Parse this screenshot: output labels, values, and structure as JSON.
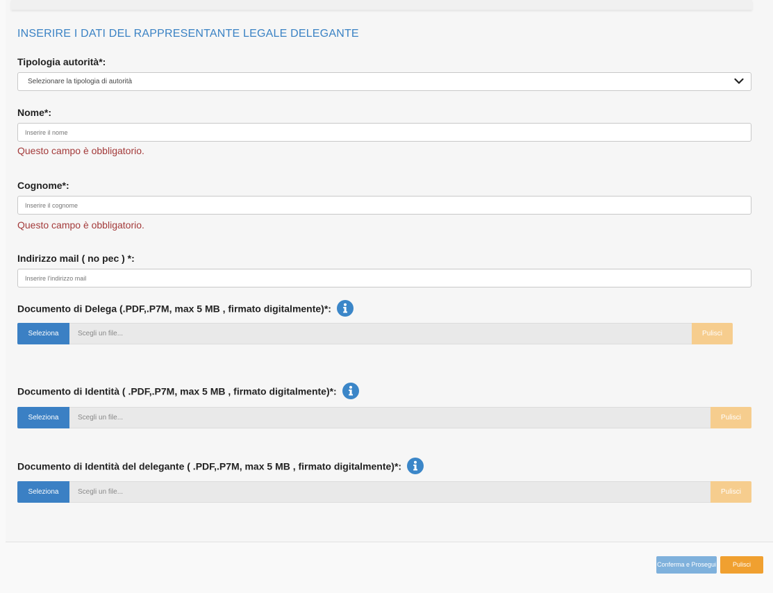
{
  "section_title": "INSERIRE I DATI DEL RAPPRESENTANTE LEGALE DELEGANTE",
  "tipologia": {
    "label": "Tipologia autorità*:",
    "selected": "Selezionare la tipologia di autorità"
  },
  "nome": {
    "label": "Nome*:",
    "placeholder": "Inserire il nome",
    "error": "Questo campo è obbligatorio."
  },
  "cognome": {
    "label": "Cognome*:",
    "placeholder": "Inserire il cognome",
    "error": "Questo campo è obbligatorio."
  },
  "email": {
    "label": "Indirizzo mail ( no pec ) *:",
    "placeholder": "Inserire l'indirizzo mail"
  },
  "uploads": [
    {
      "label": "Documento di Delega (.PDF,.P7M, max 5 MB , firmato digitalmente)*:",
      "select_label": "Seleziona",
      "file_placeholder": "Scegli un file...",
      "clear_label": "Pulisci"
    },
    {
      "label": "Documento di Identità ( .PDF,.P7M, max 5 MB , firmato digitalmente)*:",
      "select_label": "Seleziona",
      "file_placeholder": "Scegli un file...",
      "clear_label": "Pulisci"
    },
    {
      "label": "Documento di Identità del delegante ( .PDF,.P7M, max 5 MB , firmato digitalmente)*:",
      "select_label": "Seleziona",
      "file_placeholder": "Scegli un file...",
      "clear_label": "Pulisci"
    }
  ],
  "footer": {
    "confirm_label": "Conferma e Prosegui",
    "clear_label": "Pulisci"
  },
  "icons": {
    "info": "info-icon",
    "dropdown": "chevron-down-icon"
  },
  "colors": {
    "title": "#3a82c4",
    "error": "#a33a3a",
    "select_button": "#3b80c4",
    "clear_button": "#f6cd8e",
    "confirm_button": "#7fb1dc",
    "footer_clear_button": "#f0a030"
  }
}
